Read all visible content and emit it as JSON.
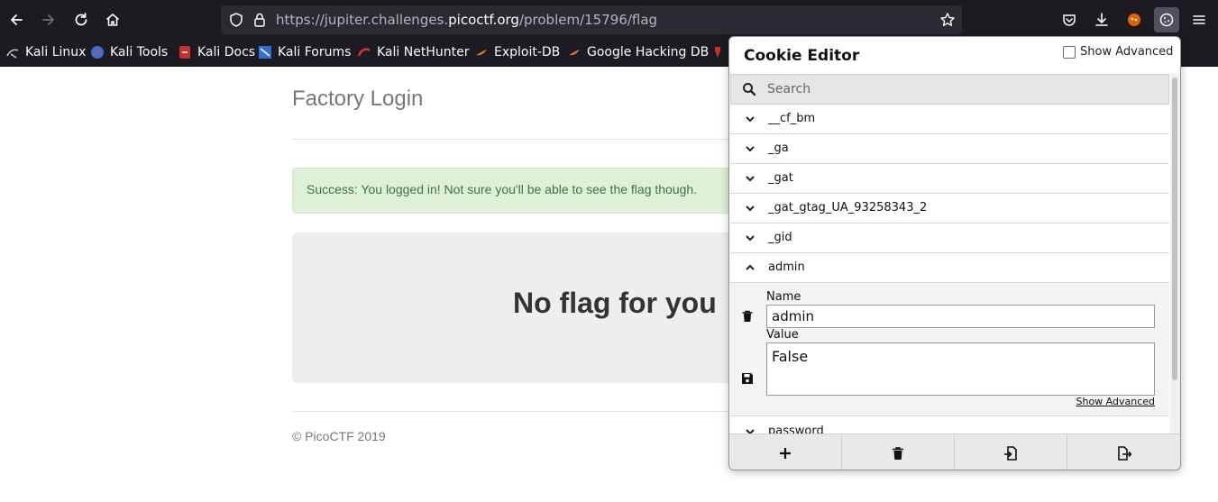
{
  "browser": {
    "url_prefix": "https://jupiter.challenges.",
    "url_domain": "picoctf.org",
    "url_path": "/problem/15796/flag",
    "bookmarks": [
      {
        "label": "Kali Linux",
        "icon": "kali-icon"
      },
      {
        "label": "Kali Tools",
        "icon": "kali-tools-icon"
      },
      {
        "label": "Kali Docs",
        "icon": "kali-docs-icon"
      },
      {
        "label": "Kali Forums",
        "icon": "kali-forums-icon"
      },
      {
        "label": "Kali NetHunter",
        "icon": "nethunter-icon"
      },
      {
        "label": "Exploit-DB",
        "icon": "exploit-db-icon"
      },
      {
        "label": "Google Hacking DB",
        "icon": "ghdb-icon"
      }
    ]
  },
  "page": {
    "title": "Factory Login",
    "alert": "Success: You logged in! Not sure you'll be able to see the flag though.",
    "jumbotron": "No flag for you",
    "footer": "© PicoCTF 2019"
  },
  "cookie_editor": {
    "title": "Cookie Editor",
    "show_advanced_label": "Show Advanced",
    "search_placeholder": "Search",
    "cookies": [
      {
        "name": "__cf_bm",
        "expanded": false
      },
      {
        "name": "_ga",
        "expanded": false
      },
      {
        "name": "_gat",
        "expanded": false
      },
      {
        "name": "_gat_gtag_UA_93258343_2",
        "expanded": false
      },
      {
        "name": "_gid",
        "expanded": false
      },
      {
        "name": "admin",
        "expanded": true
      },
      {
        "name": "password",
        "expanded": false
      }
    ],
    "editor": {
      "name_label": "Name",
      "name_value": "admin",
      "value_label": "Value",
      "value_value": "False",
      "show_advanced_link": "Show Advanced"
    },
    "bottom_actions": [
      "add-icon",
      "delete-all-icon",
      "import-icon",
      "export-icon"
    ]
  },
  "colors": {
    "toolbar_bg": "#1c1b22",
    "alert_bg": "#dff0d8",
    "alert_text": "#3c763d"
  }
}
